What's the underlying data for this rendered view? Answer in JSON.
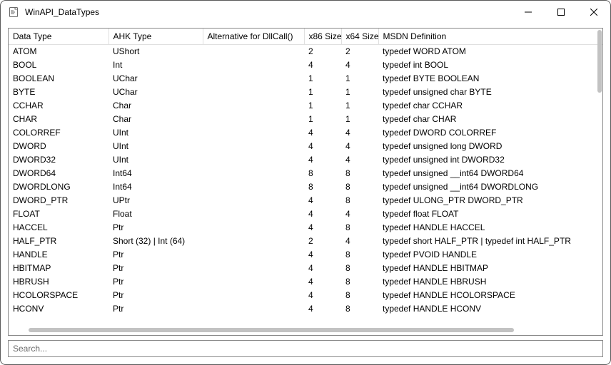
{
  "window": {
    "title": "WinAPI_DataTypes"
  },
  "headers": {
    "c0": "Data Type",
    "c1": "AHK Type",
    "c2": "Alternative for DllCall()",
    "c3": "x86 Size",
    "c4": "x64 Size",
    "c5": "MSDN Definition"
  },
  "rows": [
    {
      "dt": "ATOM",
      "ahk": "UShort",
      "alt": "",
      "x86": "2",
      "x64": "2",
      "def": "typedef WORD ATOM"
    },
    {
      "dt": "BOOL",
      "ahk": "Int",
      "alt": "",
      "x86": "4",
      "x64": "4",
      "def": "typedef int BOOL"
    },
    {
      "dt": "BOOLEAN",
      "ahk": "UChar",
      "alt": "",
      "x86": "1",
      "x64": "1",
      "def": "typedef BYTE BOOLEAN"
    },
    {
      "dt": "BYTE",
      "ahk": "UChar",
      "alt": "",
      "x86": "1",
      "x64": "1",
      "def": "typedef unsigned char BYTE"
    },
    {
      "dt": "CCHAR",
      "ahk": "Char",
      "alt": "",
      "x86": "1",
      "x64": "1",
      "def": "typedef char CCHAR"
    },
    {
      "dt": "CHAR",
      "ahk": "Char",
      "alt": "",
      "x86": "1",
      "x64": "1",
      "def": "typedef char CHAR"
    },
    {
      "dt": "COLORREF",
      "ahk": "UInt",
      "alt": "",
      "x86": "4",
      "x64": "4",
      "def": "typedef DWORD COLORREF"
    },
    {
      "dt": "DWORD",
      "ahk": "UInt",
      "alt": "",
      "x86": "4",
      "x64": "4",
      "def": "typedef unsigned long DWORD"
    },
    {
      "dt": "DWORD32",
      "ahk": "UInt",
      "alt": "",
      "x86": "4",
      "x64": "4",
      "def": "typedef unsigned int DWORD32"
    },
    {
      "dt": "DWORD64",
      "ahk": "Int64",
      "alt": "",
      "x86": "8",
      "x64": "8",
      "def": "typedef unsigned __int64 DWORD64"
    },
    {
      "dt": "DWORDLONG",
      "ahk": "Int64",
      "alt": "",
      "x86": "8",
      "x64": "8",
      "def": "typedef unsigned __int64 DWORDLONG"
    },
    {
      "dt": "DWORD_PTR",
      "ahk": "UPtr",
      "alt": "",
      "x86": "4",
      "x64": "8",
      "def": "typedef ULONG_PTR DWORD_PTR"
    },
    {
      "dt": "FLOAT",
      "ahk": "Float",
      "alt": "",
      "x86": "4",
      "x64": "4",
      "def": "typedef float FLOAT"
    },
    {
      "dt": "HACCEL",
      "ahk": "Ptr",
      "alt": "",
      "x86": "4",
      "x64": "8",
      "def": "typedef HANDLE HACCEL"
    },
    {
      "dt": "HALF_PTR",
      "ahk": "Short (32) | Int (64)",
      "alt": "",
      "x86": "2",
      "x64": "4",
      "def": "typedef short HALF_PTR | typedef int HALF_PTR"
    },
    {
      "dt": "HANDLE",
      "ahk": "Ptr",
      "alt": "",
      "x86": "4",
      "x64": "8",
      "def": "typedef PVOID HANDLE"
    },
    {
      "dt": "HBITMAP",
      "ahk": "Ptr",
      "alt": "",
      "x86": "4",
      "x64": "8",
      "def": "typedef HANDLE HBITMAP"
    },
    {
      "dt": "HBRUSH",
      "ahk": "Ptr",
      "alt": "",
      "x86": "4",
      "x64": "8",
      "def": "typedef HANDLE HBRUSH"
    },
    {
      "dt": "HCOLORSPACE",
      "ahk": "Ptr",
      "alt": "",
      "x86": "4",
      "x64": "8",
      "def": "typedef HANDLE HCOLORSPACE"
    },
    {
      "dt": "HCONV",
      "ahk": "Ptr",
      "alt": "",
      "x86": "4",
      "x64": "8",
      "def": "typedef HANDLE HCONV"
    }
  ],
  "search": {
    "placeholder": "Search..."
  }
}
